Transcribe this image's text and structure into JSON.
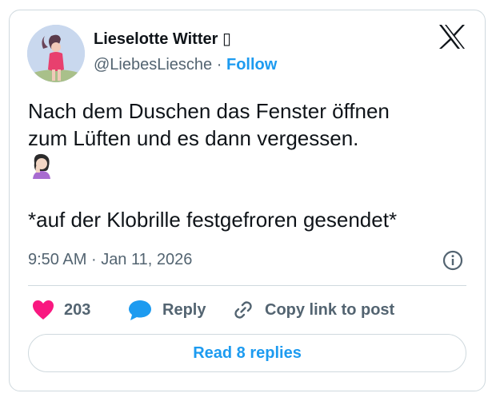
{
  "author": {
    "name": "Lieselotte Witter",
    "name_glyph": "▯",
    "handle": "@LiebesLiesche",
    "separator": "·",
    "follow_label": "Follow"
  },
  "tweet": {
    "lines": [
      "Nach dem Duschen das Fenster öffnen",
      "zum Lüften und es dann vergessen."
    ],
    "emoji": "woman-facepalming",
    "second_line": "*auf der Klobrille festgefroren gesendet*"
  },
  "timestamp": {
    "time": "9:50 AM",
    "separator": "·",
    "date": "Jan 11, 2026"
  },
  "actions": {
    "like_count": "203",
    "reply_label": "Reply",
    "copy_label": "Copy link to post"
  },
  "read_replies_label": "Read 8 replies",
  "colors": {
    "accent": "#1d9bf0",
    "like": "#f91880",
    "text": "#0f1419",
    "muted": "#536471",
    "border": "#cfd9de"
  },
  "icons": [
    "x-logo-icon",
    "info-icon",
    "heart-icon",
    "reply-bubble-icon",
    "link-icon"
  ]
}
